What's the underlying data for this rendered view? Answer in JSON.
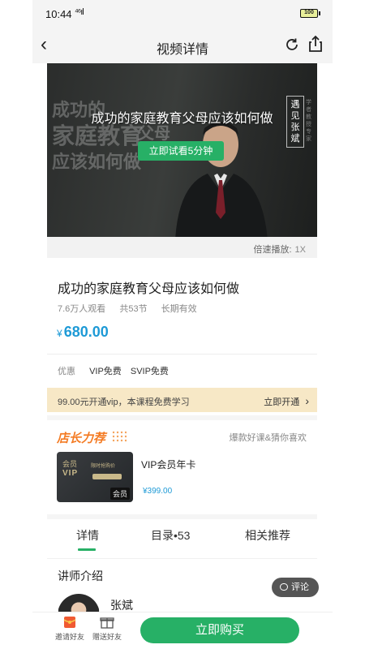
{
  "status_bar": {
    "time": "10:44",
    "signal": "⁴⁶ıl",
    "battery": "100"
  },
  "nav": {
    "title": "视频详情"
  },
  "video": {
    "title": "成功的家庭教育父母应该如何做",
    "bg_line1": "成功的",
    "bg_line2": "家庭教育",
    "bg_line3": "应该如何做",
    "bg_line4": "父母",
    "badge": "遇见张斌",
    "small_text": "学者 教授 专家",
    "try_button": "立即试看5分钟",
    "speed_label": "倍速播放:",
    "speed_value": "1X"
  },
  "course": {
    "title": "成功的家庭教育父母应该如何做",
    "views": "7.6万人观看",
    "lessons": "共53节",
    "validity": "长期有效",
    "price_symbol": "¥",
    "price": "680.00"
  },
  "promo": {
    "label": "优惠",
    "vip": "VIP免费",
    "svip": "SVIP免费"
  },
  "vip_bar": {
    "text": "99.00元开通vip，本课程免费学习",
    "action": "立即开通"
  },
  "recommend": {
    "title": "店长力荐",
    "subtitle": "爆款好课&猜你喜欢",
    "item": {
      "card_label_1": "会员",
      "card_label_2": "VIP",
      "card_mid": "限时抢购价",
      "card_tag": "会员",
      "name": "VIP会员年卡",
      "price": "¥399.00"
    }
  },
  "tabs": [
    "详情",
    "目录•53",
    "相关推荐"
  ],
  "teacher": {
    "section_title": "讲师介绍",
    "name": "张斌"
  },
  "comment_button": "评论",
  "bottom": {
    "invite": "邀请好友",
    "gift": "赠送好友",
    "buy": "立即购买"
  },
  "colors": {
    "accent_green": "#27b066",
    "price_blue": "#1e9ad6",
    "rec_orange": "#f47b23"
  }
}
